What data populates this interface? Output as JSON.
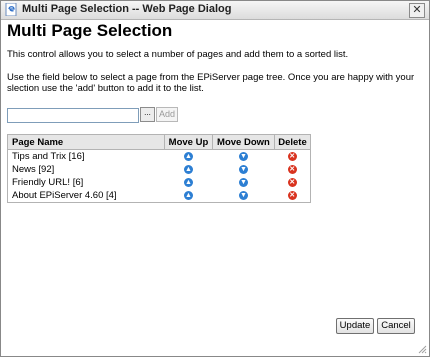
{
  "window": {
    "title": "Multi Page Selection -- Web Page Dialog",
    "close_label": "✕"
  },
  "heading": "Multi Page Selection",
  "intro": "This control allows you to select a number of pages and add them to a sorted list.",
  "instructions": "Use the field below to select a page from the EPiServer page tree. Once you are happy with your slection use the 'add' button to add it to the list.",
  "picker": {
    "value": "",
    "browse_label": "...",
    "add_label": "Add"
  },
  "table": {
    "headers": {
      "name": "Page Name",
      "move_up": "Move Up",
      "move_down": "Move Down",
      "delete": "Delete"
    },
    "rows": [
      {
        "name": "Tips and Trix [16]"
      },
      {
        "name": "News [92]"
      },
      {
        "name": "Friendly URL! [6]"
      },
      {
        "name": "About EPiServer 4.60 [4]"
      }
    ],
    "icons": {
      "move_up": "arrow-up-circle-icon",
      "move_down": "arrow-down-circle-icon",
      "delete": "delete-x-circle-icon"
    }
  },
  "buttons": {
    "update": "Update",
    "cancel": "Cancel"
  }
}
